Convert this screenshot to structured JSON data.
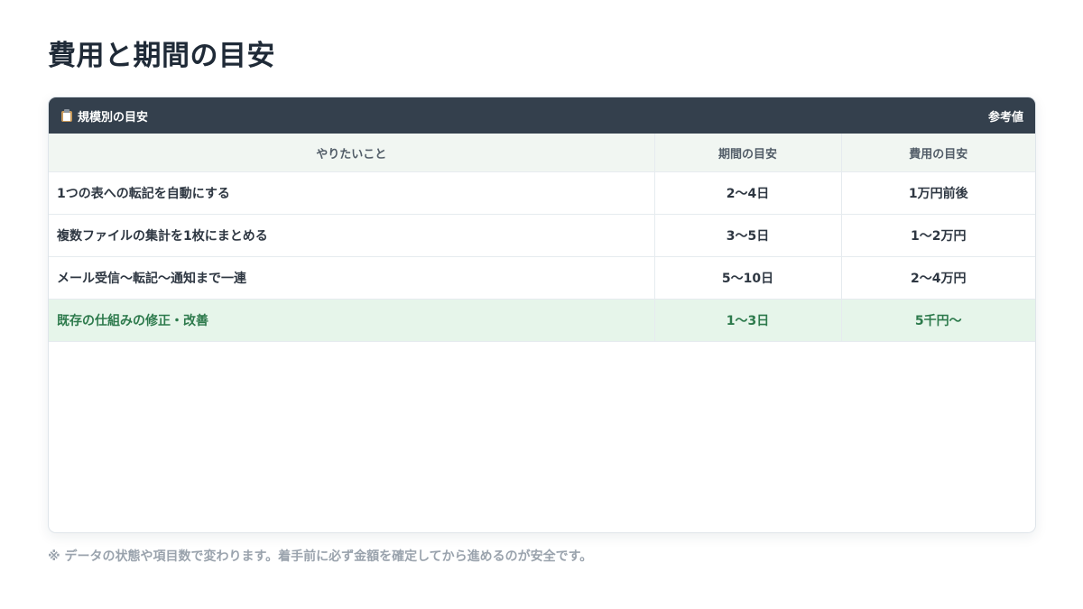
{
  "page": {
    "title": "費用と期間の目安",
    "footnote": "※ データの状態や項目数で変わります。着手前に必ず金額を確定してから進めるのが安全です。"
  },
  "card": {
    "icon": "clipboard-icon",
    "title": "規模別の目安",
    "badge": "参考値",
    "header_color": "#34404d"
  },
  "table": {
    "columns": [
      "やりたいこと",
      "期間の目安",
      "費用の目安"
    ],
    "rows": [
      {
        "task": "1つの表への転記を自動にする",
        "duration": "2〜4日",
        "cost": "1万円前後"
      },
      {
        "task": "複数ファイルの集計を1枚にまとめる",
        "duration": "3〜5日",
        "cost": "1〜2万円"
      },
      {
        "task": "メール受信〜転記〜通知まで一連",
        "duration": "5〜10日",
        "cost": "2〜4万円"
      },
      {
        "task": "既存の仕組みの修正・改善",
        "duration": "1〜3日",
        "cost": "5千円〜",
        "highlight": true
      }
    ],
    "highlight_color": "#2d7a4c"
  }
}
